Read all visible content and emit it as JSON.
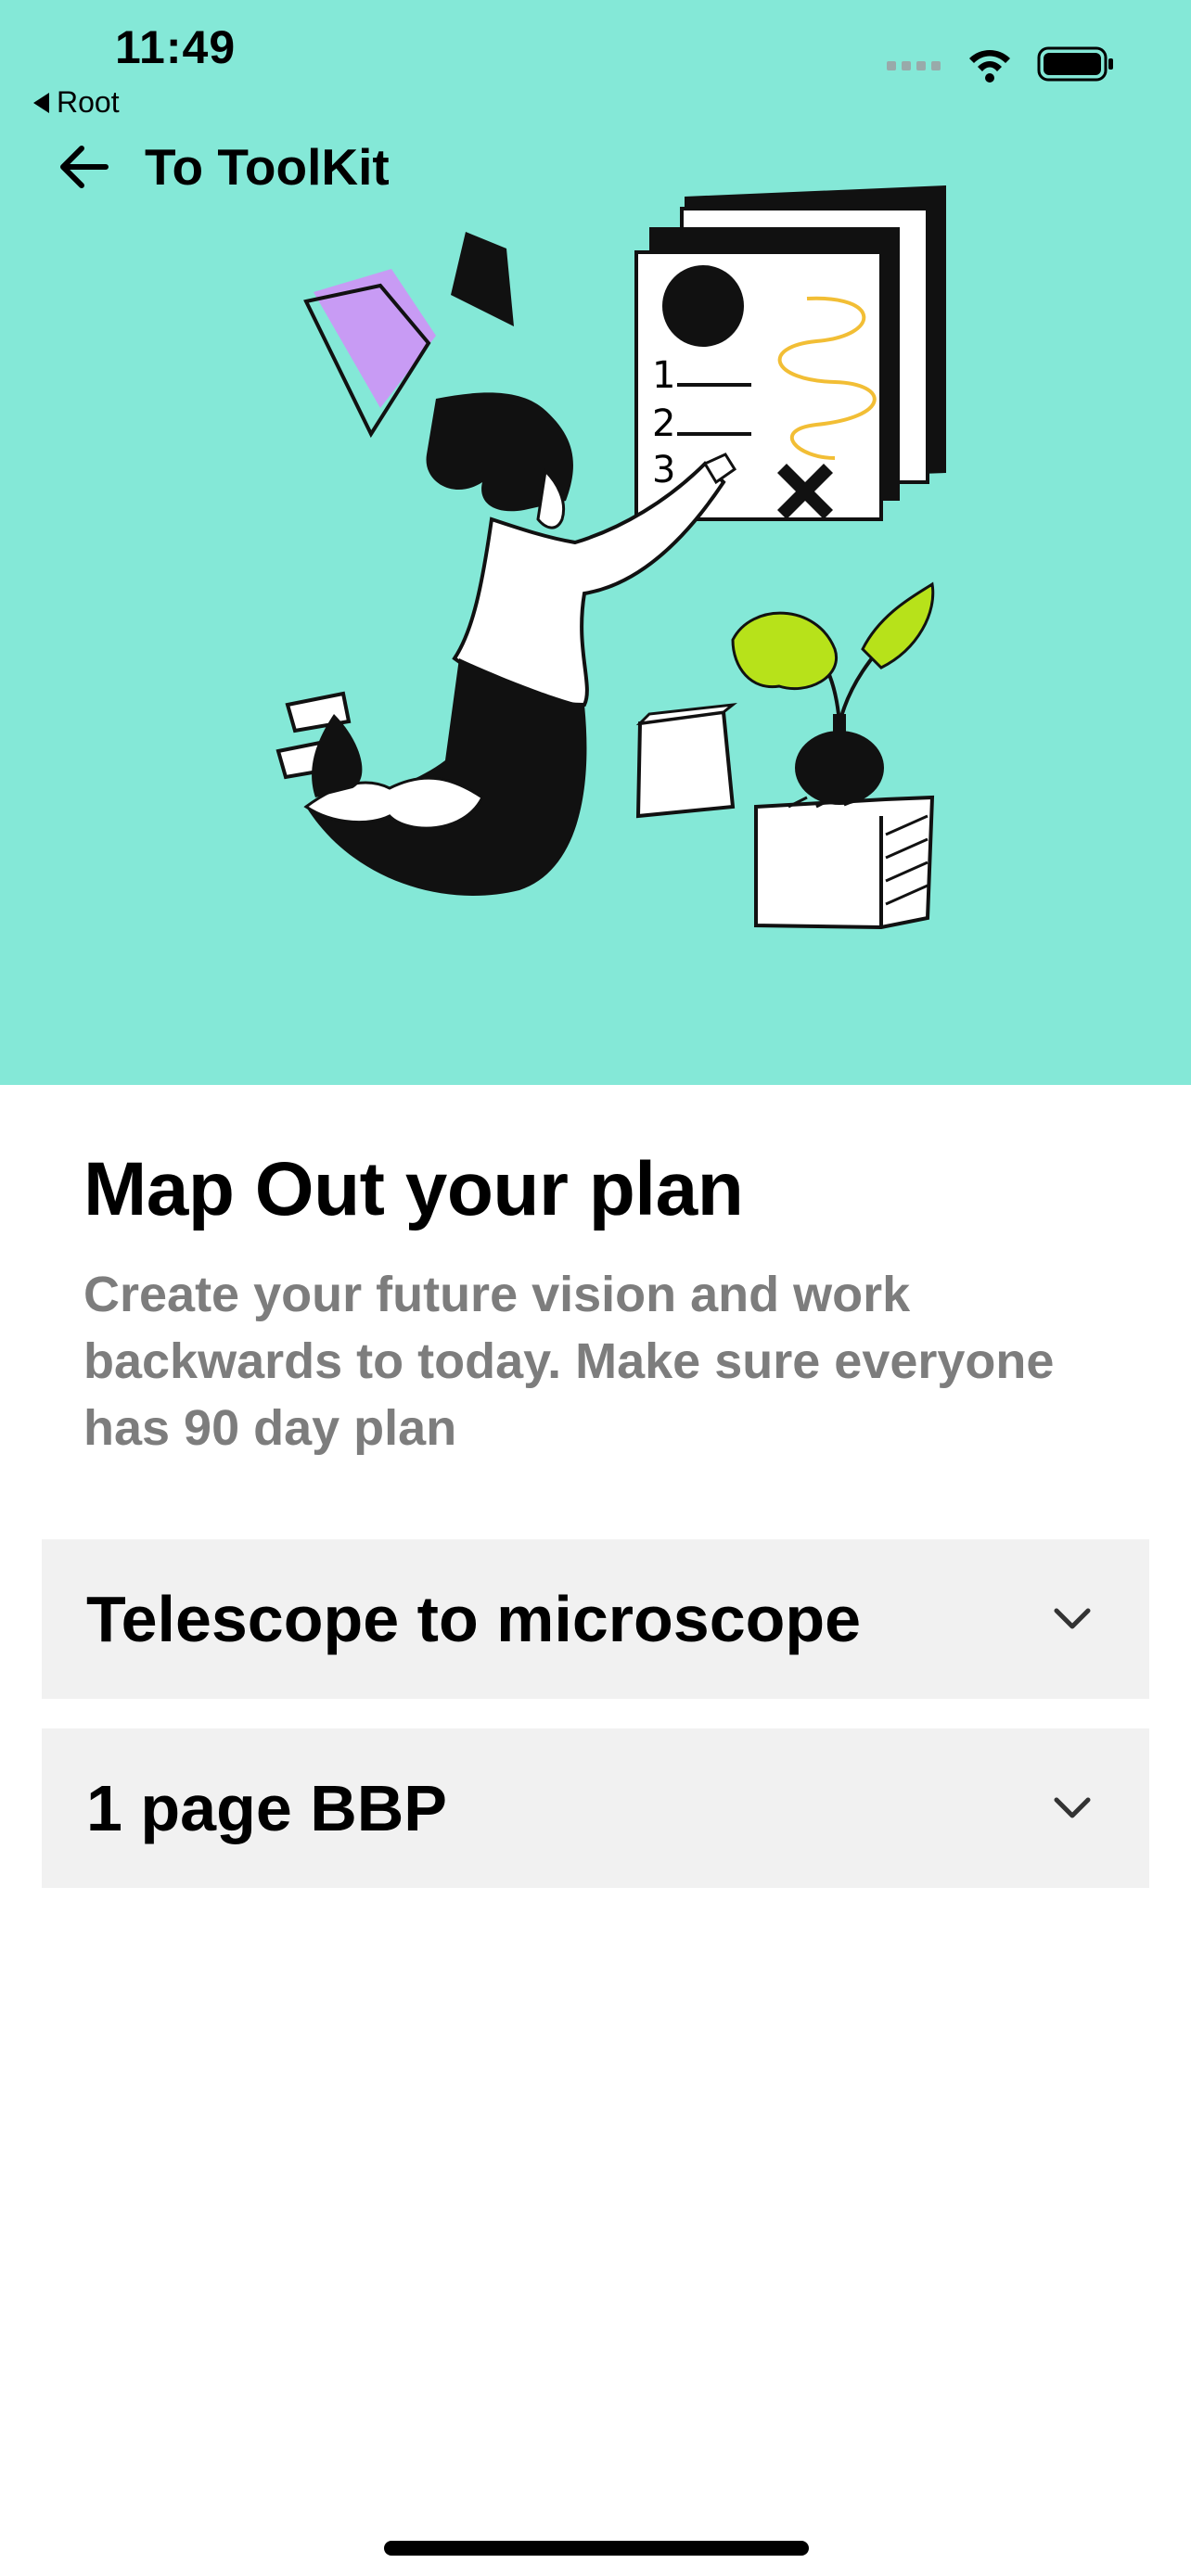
{
  "status_bar": {
    "time": "11:49",
    "back_app": "Root"
  },
  "nav": {
    "title": "To ToolKit"
  },
  "hero": {
    "illustration_icon": "planning-illustration",
    "background": "#84E8D7"
  },
  "section": {
    "title": "Map Out your plan",
    "description": "Create your future vision and work backwards to today. Make sure everyone has 90 day plan"
  },
  "accordion": [
    {
      "label": "Telescope to microscope"
    },
    {
      "label": "1 page BBP"
    }
  ]
}
